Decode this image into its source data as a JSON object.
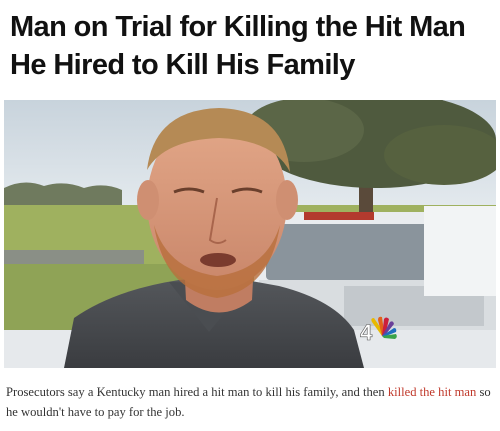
{
  "article": {
    "headline": "Man on Trial for Killing the Hit Man He Hired to Kill His Family",
    "photo": {
      "watermark_icon": "nbc-peacock-icon",
      "watermark_channel": "4"
    },
    "caption": {
      "text_before": "Prosecutors say a Kentucky man hired a hit man to kill his family, and then ",
      "link_text": "killed the hit man",
      "text_after": " so he wouldn't have to pay for the job.",
      "link_color": "#c0392b"
    }
  }
}
